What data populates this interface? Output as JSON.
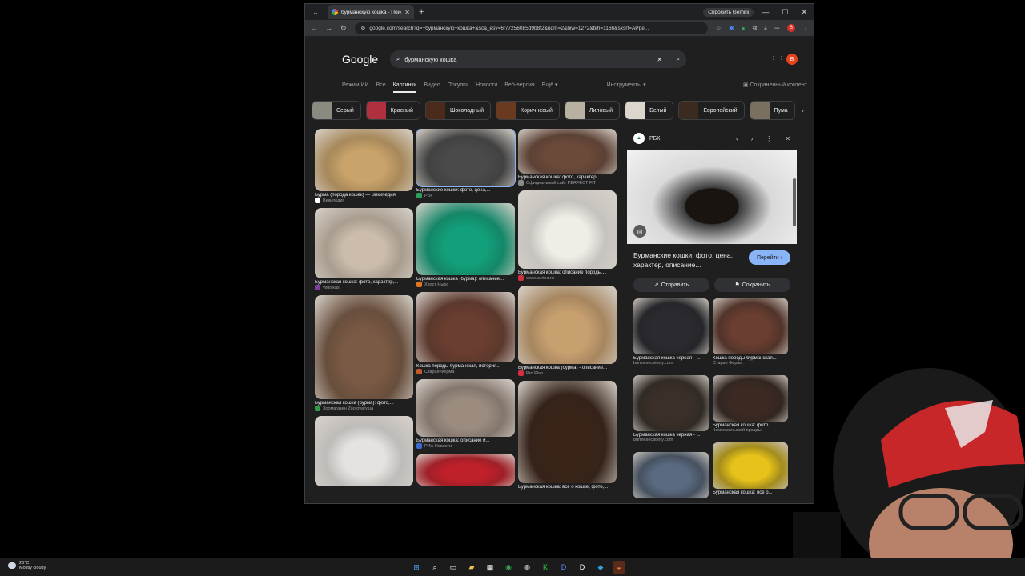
{
  "browser": {
    "tab_title": "бурманскую кошка - Поиск в",
    "gemini_label": "Спросить Gemini",
    "url": "google.com/search?q=+бурманскую+кошка+&sca_esv=6f77256085d9b8f2&udm=2&biw=1272&bih=1166&sxsrf=APpe...",
    "profile_initial": "B"
  },
  "google": {
    "logo": "Google",
    "query": "бурманскую кошка",
    "user_initial": "B",
    "nav": [
      "Режим ИИ",
      "Все",
      "Картинки",
      "Видео",
      "Покупки",
      "Новости",
      "Веб-версия",
      "Ещё"
    ],
    "tools": "Инструменты",
    "safe": "Сохраненный контент"
  },
  "chips": [
    {
      "label": "Серый",
      "color": "#8a8a80"
    },
    {
      "label": "Красный",
      "color": "#b03040"
    },
    {
      "label": "Шоколадный",
      "color": "#4a2a1a"
    },
    {
      "label": "Коричневый",
      "color": "#6a3a20"
    },
    {
      "label": "Лиловый",
      "color": "#b8b0a0"
    },
    {
      "label": "Белый",
      "color": "#ddd6cc"
    },
    {
      "label": "Европейский",
      "color": "#3a2a20"
    },
    {
      "label": "Пума",
      "color": "#7a7060"
    }
  ],
  "results": {
    "col1": [
      {
        "caption": "Бурма (порода кошек) — Википедия",
        "source": "Википедия",
        "color": "#c9a36a",
        "h": 78,
        "icon": "#ffffff"
      },
      {
        "caption": "Бурманская кошка: фото, характер,...",
        "source": "Whiskas",
        "color": "#cbbcab",
        "h": 88,
        "icon": "#7b3fa0"
      },
      {
        "caption": "Бурманская кошка (бурма): фото,...",
        "source": "Зоомагазин Zootovary.ua",
        "color": "#7a5a44",
        "h": 130,
        "icon": "#2d9b4a"
      },
      {
        "caption": "",
        "source": "",
        "color": "#e6e2df",
        "h": 88,
        "icon": "#999999"
      }
    ],
    "col2": [
      {
        "caption": "Бурманские кошки: фото, цена,...",
        "source": "РБК",
        "color": "#4a4a4a",
        "h": 72,
        "icon": "#2da05a"
      },
      {
        "caption": "Бурманская кошка (бурма): описание...",
        "source": "Хвост Ньюс",
        "color": "#12a07a",
        "h": 90,
        "icon": "#e0761e"
      },
      {
        "caption": "Кошка породы бурманская, история...",
        "source": "Старая Ферма",
        "color": "#6a3e30",
        "h": 88,
        "icon": "#c05a2a"
      },
      {
        "caption": "Бурманская кошка: описание и...",
        "source": "РИА Новости",
        "color": "#9c8c80",
        "h": 72,
        "icon": "#3a6ad0"
      },
      {
        "caption": "",
        "source": "",
        "color": "#c0202a",
        "h": 40,
        "icon": "#999999"
      }
    ],
    "col3": [
      {
        "caption": "Бурманская кошка: фото, характер,...",
        "source": "Официальный сайт PERFECT FIT",
        "color": "#6b4a3a",
        "h": 56,
        "icon": "#8a8a8a"
      },
      {
        "caption": "Бурманская кошка: описание породы,...",
        "source": "www.purina.ru",
        "color": "#f0ece6",
        "h": 98,
        "icon": "#d03040"
      },
      {
        "caption": "Бурманская кошка (бурма) - описание...",
        "source": "Pro Plan",
        "color": "#c8a070",
        "h": 98,
        "icon": "#d03040"
      },
      {
        "caption": "Бурманская кошка: все о кошке, фото,...",
        "source": "",
        "color": "#3a2418",
        "h": 128,
        "icon": "#999999"
      }
    ]
  },
  "panel": {
    "source": "РБК",
    "title": "Бурманские кошки: фото, цена, характер, описание...",
    "goto": "Перейти",
    "share": "Отправить",
    "save": "Сохранить",
    "related": [
      {
        "caption": "Бурманская кошка черная - ...",
        "source": "burmesecattery.com",
        "color": "#2a2a30"
      },
      {
        "caption": "Кошка породы бурманская...",
        "source": "Старая Ферма",
        "color": "#6a3e30"
      },
      {
        "caption": "Бурманская кошка черная - ...",
        "source": "burmesecattery.com",
        "color": "#3a3028"
      },
      {
        "caption": "Бурманская кошка: фото...",
        "source": "Комсомольской правды",
        "color": "#3c2a22"
      },
      {
        "caption": "",
        "source": "",
        "color": "#5a6a80"
      },
      {
        "caption": "Бурманская кошка: все о...",
        "source": "",
        "color": "#e6c21a"
      }
    ]
  },
  "taskbar": {
    "temp": "23°C",
    "weather": "Mostly cloudy"
  }
}
